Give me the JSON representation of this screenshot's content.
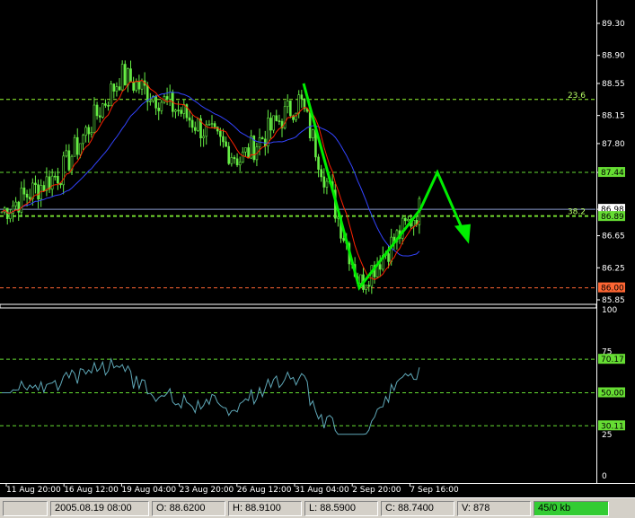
{
  "chart": {
    "price_axis_labels": [
      "89.30",
      "88.90",
      "88.55",
      "88.15",
      "87.80",
      "87.44",
      "86.98",
      "86.65",
      "86.25",
      "85.85"
    ],
    "level_tags": [
      {
        "label": "87.44",
        "color": "#66dd33"
      },
      {
        "label": "86.98",
        "color": "#ffffff"
      },
      {
        "label": "86.89",
        "color": "#66dd33"
      },
      {
        "label": "86.00",
        "color": "#ff6633"
      }
    ],
    "fib_labels": [
      "23.6",
      "38.2"
    ],
    "indicator_axis_labels": [
      "100",
      "75",
      "50",
      "25",
      "0"
    ],
    "indicator_tags": [
      "70.17",
      "50.00",
      "30.11"
    ],
    "time_labels": [
      "11 Aug 20:00",
      "16 Aug 12:00",
      "19 Aug 04:00",
      "23 Aug 20:00",
      "26 Aug 12:00",
      "31 Aug 04:00",
      "2 Sep 20:00",
      "7 Sep 16:00"
    ],
    "colors": {
      "candle": "#66ee44",
      "ma_fast": "#ff2200",
      "ma_slow": "#3344ff",
      "rsi": "#5fa8b8",
      "fib_line": "#99ff33",
      "level_line": "#66dd33",
      "support_line": "#ff6633",
      "pattern_arrow": "#00ee00"
    }
  },
  "chart_data": {
    "type": "candlestick",
    "x": [
      "11 Aug 20:00",
      "16 Aug 12:00",
      "19 Aug 04:00",
      "23 Aug 20:00",
      "26 Aug 12:00",
      "31 Aug 04:00",
      "2 Sep 20:00",
      "7 Sep 16:00"
    ],
    "close": [
      86.95,
      87.45,
      88.65,
      88.2,
      87.6,
      88.35,
      86.05,
      86.98
    ],
    "ylim": [
      85.85,
      89.3
    ],
    "levels": [
      87.44,
      86.98,
      86.89,
      86.0
    ],
    "fib_levels": [
      {
        "label": "23.6",
        "value": 88.35
      },
      {
        "label": "38.2",
        "value": 86.9
      }
    ],
    "indicator": {
      "ylim": [
        0,
        100
      ],
      "levels": [
        70.17,
        50.0,
        30.11
      ]
    }
  },
  "status": {
    "empty": "",
    "date": "2005.08.19 08:00",
    "open": "O: 88.6200",
    "high": "H: 88.9100",
    "low": "L: 88.5900",
    "close": "C: 88.7400",
    "volume": "V: 878",
    "net": "45/0 kb"
  }
}
